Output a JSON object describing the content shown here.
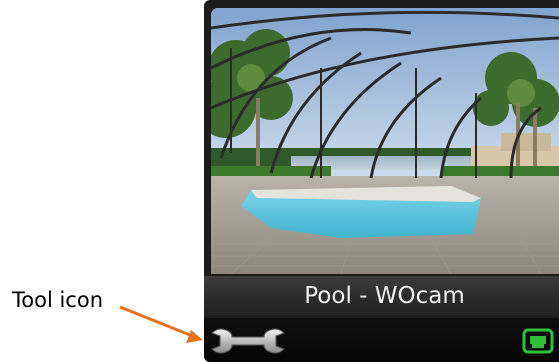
{
  "annotation": {
    "label": "Tool icon",
    "arrow_color": "#e8731f"
  },
  "camera": {
    "name": "Pool - WOcam",
    "scene": "screened-lanai-pool"
  },
  "toolbar": {
    "tool_icon": "wrench-icon",
    "network_icon": "network-status-icon",
    "network_status_color": "#2fbf3a"
  }
}
